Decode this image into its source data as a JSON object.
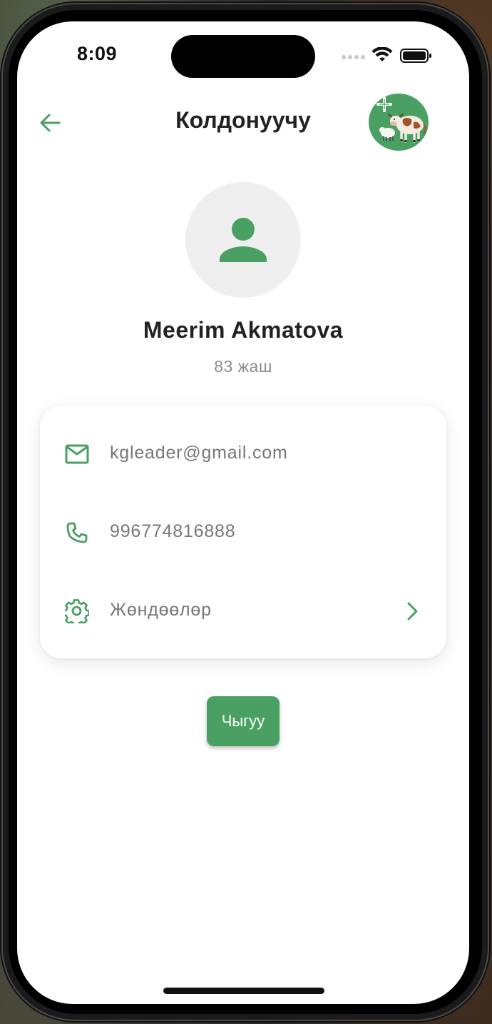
{
  "status_bar": {
    "time": "8:09"
  },
  "header": {
    "title": "Колдонуучу",
    "back_icon": "arrow-left-icon",
    "logo_icon": "livestock-logo"
  },
  "profile": {
    "avatar_icon": "person-icon",
    "name": "Meerim Akmatova",
    "age": "83 жаш"
  },
  "info_card": {
    "email": "kgleader@gmail.com",
    "phone": "996774816888",
    "settings_label": "Жөндөөлөр"
  },
  "actions": {
    "logout_label": "Чыгуу"
  },
  "colors": {
    "accent": "#4aa062",
    "text_primary": "#222222",
    "text_secondary": "#777777",
    "avatar_bg": "#efefef"
  }
}
